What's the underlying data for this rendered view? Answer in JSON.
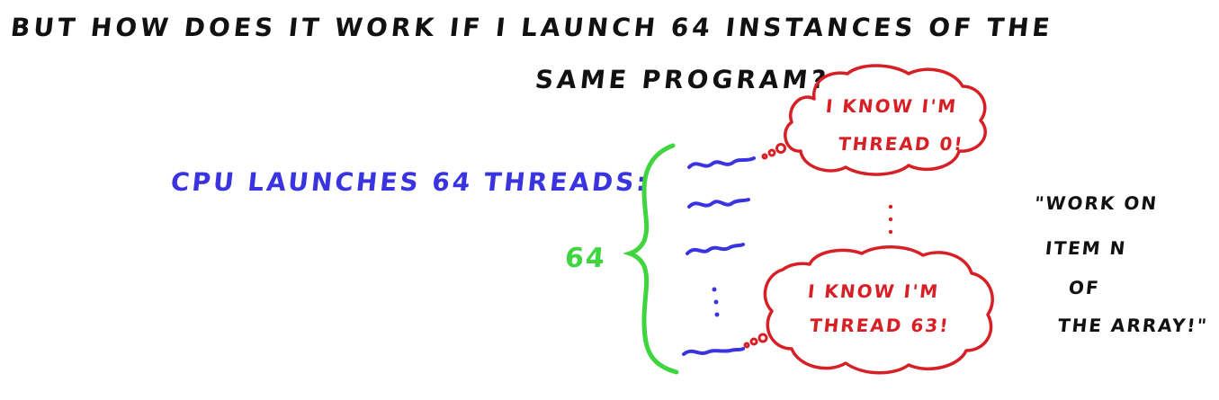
{
  "question": {
    "line1": "But how does it work if I launch 64 instances of the",
    "line2": "same program?"
  },
  "cpu_label": "CPU launches 64 threads:",
  "thread_count_label": "64",
  "bubbles": {
    "first": {
      "line1": "I know I'm",
      "line2": "thread 0!"
    },
    "last": {
      "line1": "I know I'm",
      "line2": "thread 63!"
    }
  },
  "quote": {
    "line1": "\"Work on",
    "line2": "item N",
    "line3": "of",
    "line4": "the array!\""
  },
  "colors": {
    "text": "#111111",
    "cpu_label": "#3a34e0",
    "brace": "#3fd53f",
    "threads": "#3a34e0",
    "bubbles": "#d71f26"
  }
}
